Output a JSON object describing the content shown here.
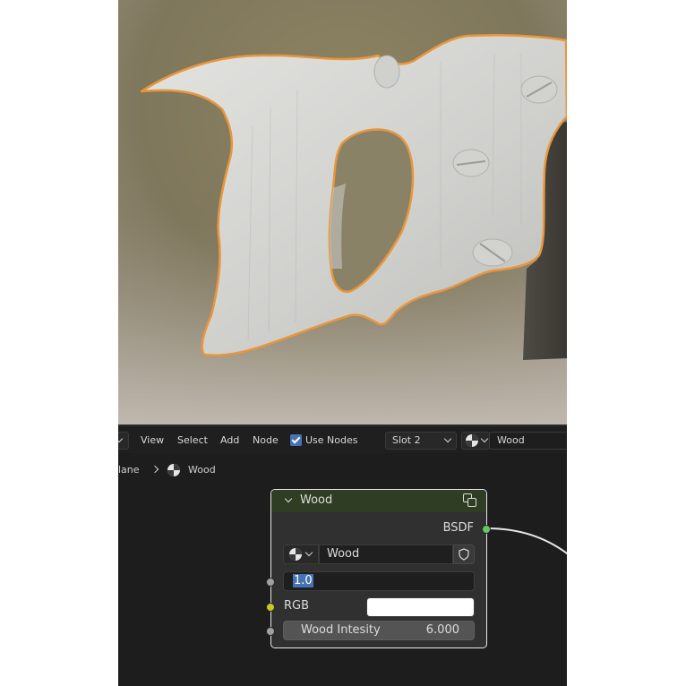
{
  "header": {
    "menu": [
      "View",
      "Select",
      "Add",
      "Node"
    ],
    "use_nodes_label": "Use Nodes",
    "use_nodes_checked": true,
    "slot_label": "Slot 2",
    "material_name": "Wood"
  },
  "breadcrumb": {
    "object": "lane",
    "material": "Wood"
  },
  "node": {
    "title": "Wood",
    "output_label": "BSDF",
    "material_name": "Wood",
    "value_field": "1.0",
    "rgb_label": "RGB",
    "rgb_color": "#ffffff",
    "intensity_label": "Wood Intesity",
    "intensity_value": "6.000"
  },
  "colors": {
    "selection_outline": "#e8963c",
    "node_header": "#2e3d23",
    "socket_shader": "#63c763",
    "socket_color": "#c7c729",
    "socket_float": "#a1a1a1",
    "accent": "#4772b3"
  }
}
